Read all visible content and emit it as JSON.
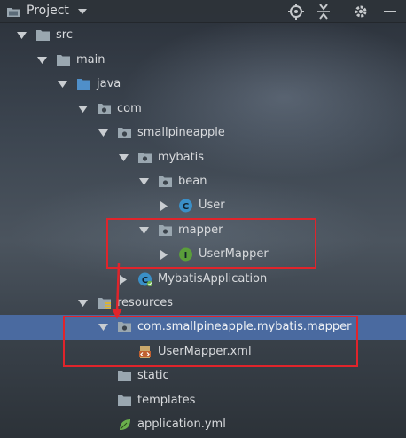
{
  "toolbar": {
    "view_label": "Project",
    "icons": [
      "project-folder-icon",
      "dropdown-caret-icon",
      "locate-crosshair-icon",
      "collapse-all-icon",
      "settings-gear-icon",
      "hide-minus-icon"
    ]
  },
  "tree": {
    "nodes": [
      {
        "label": "src",
        "expanded": true,
        "icon": "folder-icon"
      },
      {
        "label": "main",
        "expanded": true,
        "icon": "folder-icon"
      },
      {
        "label": "java",
        "expanded": true,
        "icon": "source-root-folder-icon"
      },
      {
        "label": "com",
        "expanded": true,
        "icon": "package-icon"
      },
      {
        "label": "smallpineapple",
        "expanded": true,
        "icon": "package-icon"
      },
      {
        "label": "mybatis",
        "expanded": true,
        "icon": "package-icon"
      },
      {
        "label": "bean",
        "expanded": true,
        "icon": "package-icon"
      },
      {
        "label": "User",
        "expanded": false,
        "icon": "class-icon",
        "badge": "C"
      },
      {
        "label": "mapper",
        "expanded": true,
        "icon": "package-icon"
      },
      {
        "label": "UserMapper",
        "expanded": false,
        "icon": "interface-icon",
        "badge": "I"
      },
      {
        "label": "MybatisApplication",
        "expanded": false,
        "icon": "spring-boot-class-icon",
        "badge": "C"
      },
      {
        "label": "resources",
        "expanded": true,
        "icon": "resources-root-folder-icon"
      },
      {
        "label": "com.smallpineapple.mybatis.mapper",
        "expanded": true,
        "icon": "package-icon",
        "selected": true
      },
      {
        "label": "UserMapper.xml",
        "icon": "xml-file-icon"
      },
      {
        "label": "static",
        "icon": "folder-icon"
      },
      {
        "label": "templates",
        "icon": "folder-icon"
      },
      {
        "label": "application.yml",
        "icon": "spring-yml-icon"
      }
    ]
  },
  "colors": {
    "selection": "#4a6aa0",
    "annotation": "#e0242b",
    "folder": "#9aa7b0",
    "source_root": "#4f8fc9",
    "class_badge": "#3a8fc7",
    "interface_badge": "#5a9e3a"
  }
}
